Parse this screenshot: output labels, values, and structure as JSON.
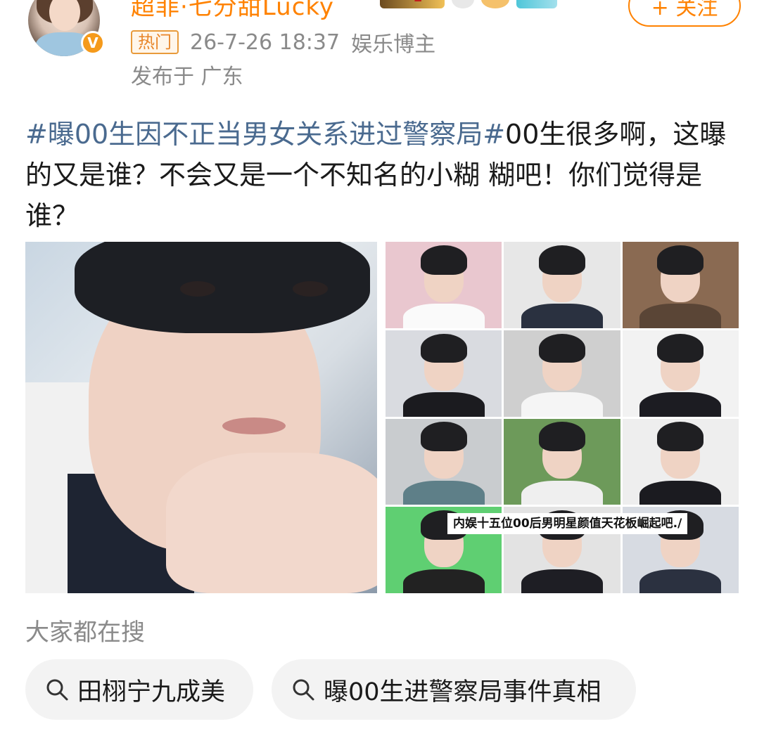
{
  "header": {
    "username": "超菲·七分甜Lucky",
    "follow_label": "+ 关注",
    "verified_mark": "V",
    "badge_level": "2",
    "hot_tag": "热门",
    "timestamp": "26-7-26 18:37",
    "role": "娱乐博主",
    "location": "发布于 广东"
  },
  "post": {
    "hashtag": "#曝00生因不正当男女关系进过警察局#",
    "text_line": "00生很多啊，这曝的又是谁？不会又是一个不知名的小糊  糊吧！你们觉得是谁？"
  },
  "images": {
    "collage_caption": "内娱十五位00后男明星颜值天花板崛起吧./"
  },
  "search": {
    "heading": "大家都在搜",
    "chips": [
      {
        "label": "田栩宁九成美"
      },
      {
        "label": "曝00生进警察局事件真相"
      }
    ]
  },
  "colors": {
    "accent": "#ff8200",
    "hashtag": "#4a6a8f",
    "muted": "#8a8a8a",
    "chip_bg": "#f3f3f3"
  }
}
